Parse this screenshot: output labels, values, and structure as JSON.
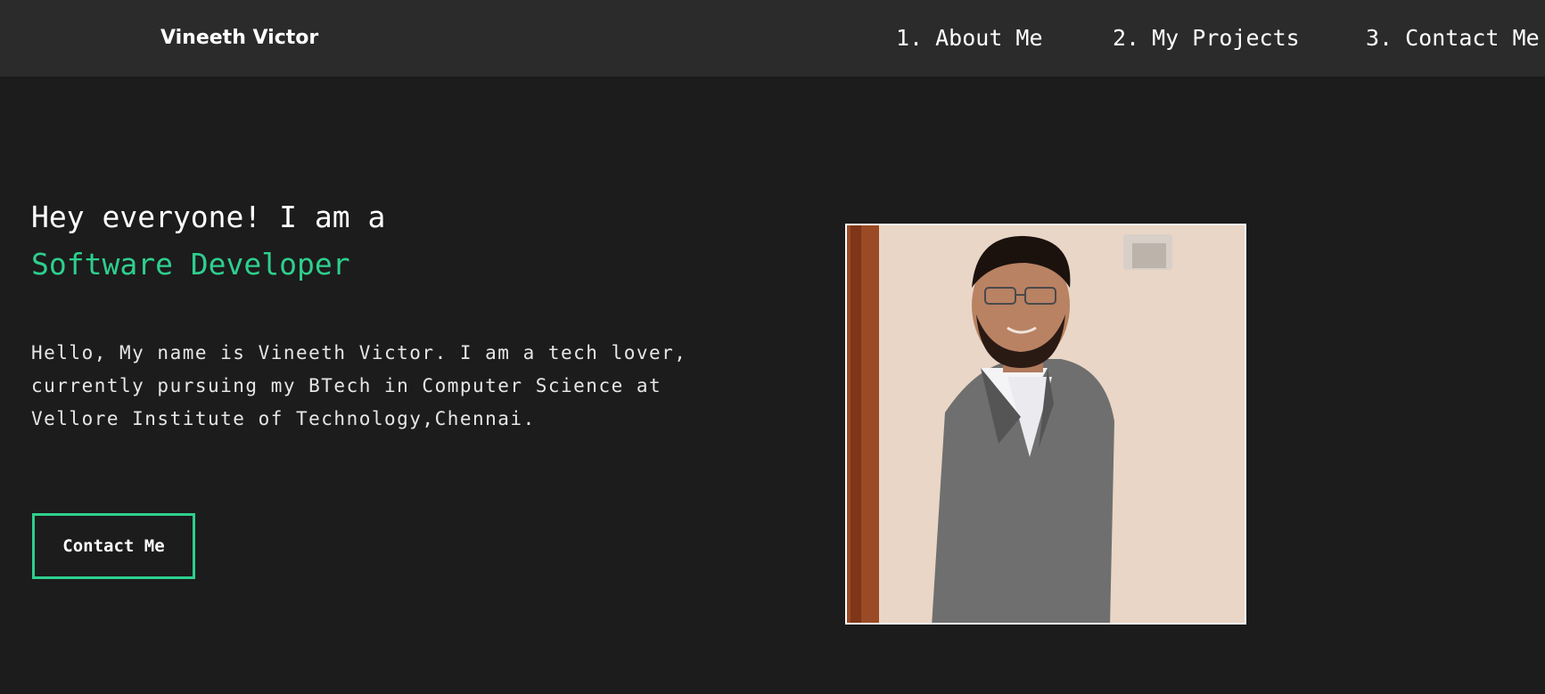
{
  "nav": {
    "brand": "Vineeth Victor",
    "links": [
      {
        "num": "1.",
        "label": "About Me"
      },
      {
        "num": "2.",
        "label": "My Projects"
      },
      {
        "num": "3.",
        "label": "Contact Me"
      }
    ]
  },
  "hero": {
    "greeting": "Hey everyone! I am a",
    "role": "Software Developer",
    "intro": "Hello, My name is Vineeth Victor. I am a tech lover, currently pursuing my BTech in Computer Science at Vellore Institute of Technology,Chennai.",
    "cta_label": "Contact Me",
    "photo": "profile-photo"
  },
  "colors": {
    "background": "#1c1c1c",
    "navbar": "#2b2b2b",
    "accent": "#2ecf8e",
    "text": "#ffffff"
  }
}
